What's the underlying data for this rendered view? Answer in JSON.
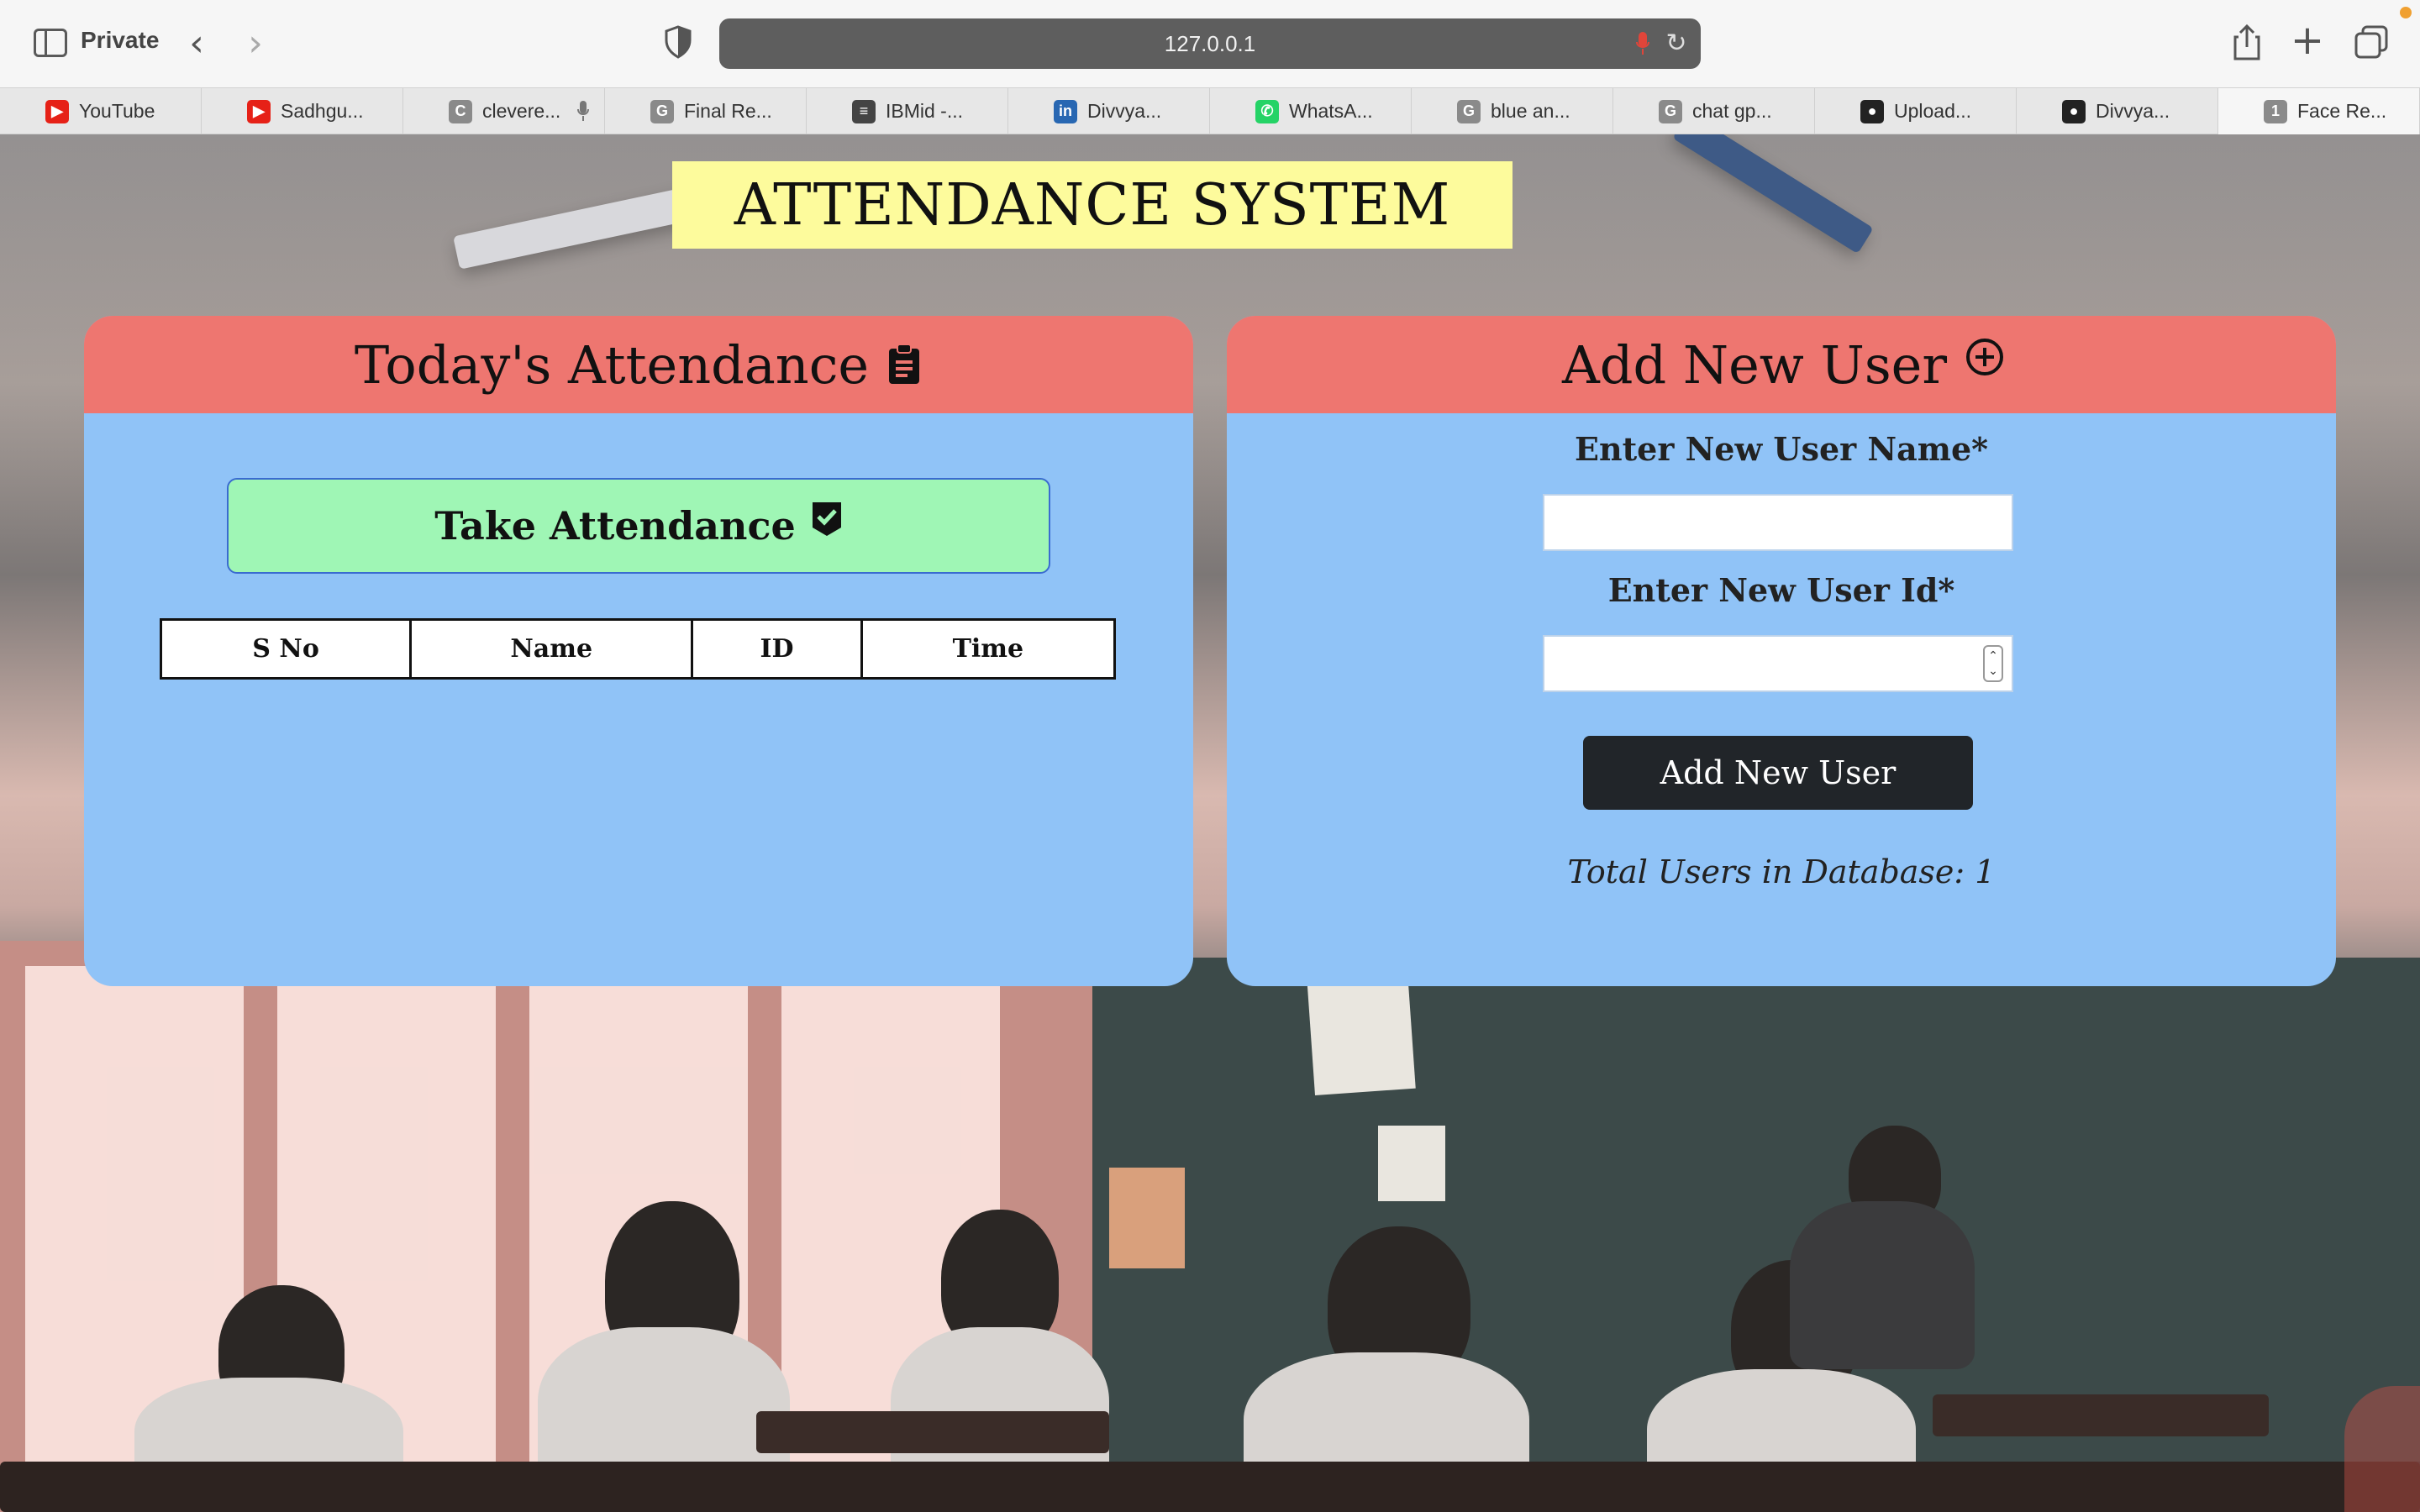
{
  "browser": {
    "private_label": "Private",
    "url": "127.0.0.1",
    "tabs": [
      {
        "label": "YouTube",
        "icon": "youtube-icon",
        "color": "#e62117",
        "glyph": "▶"
      },
      {
        "label": "Sadhgu...",
        "icon": "youtube-icon",
        "color": "#e62117",
        "glyph": "▶"
      },
      {
        "label": "clevere...",
        "icon": "letter-c-icon",
        "color": "#8a8a8a",
        "glyph": "C"
      },
      {
        "label": "Final Re...",
        "icon": "letter-g-icon",
        "color": "#8a8a8a",
        "glyph": "G"
      },
      {
        "label": "IBMid -...",
        "icon": "ibm-icon",
        "color": "#444444",
        "glyph": "≡"
      },
      {
        "label": "Divvya...",
        "icon": "linkedin-icon",
        "color": "#2867b2",
        "glyph": "in"
      },
      {
        "label": "WhatsA...",
        "icon": "whatsapp-icon",
        "color": "#25d366",
        "glyph": "✆"
      },
      {
        "label": "blue an...",
        "icon": "letter-g-icon",
        "color": "#8a8a8a",
        "glyph": "G"
      },
      {
        "label": "chat gp...",
        "icon": "letter-g-icon",
        "color": "#8a8a8a",
        "glyph": "G"
      },
      {
        "label": "Upload...",
        "icon": "github-icon",
        "color": "#222222",
        "glyph": "●"
      },
      {
        "label": "Divvya...",
        "icon": "github-icon",
        "color": "#222222",
        "glyph": "●"
      },
      {
        "label": "Face Re...",
        "icon": "number-1-icon",
        "color": "#8a8a8a",
        "glyph": "1"
      }
    ]
  },
  "page": {
    "title": "ATTENDANCE SYSTEM",
    "attendance_card": {
      "title": "Today's Attendance",
      "take_button": "Take Attendance",
      "columns": [
        "S No",
        "Name",
        "ID",
        "Time"
      ]
    },
    "add_user_card": {
      "title": "Add New User",
      "name_label": "Enter New User Name*",
      "name_value": "",
      "id_label": "Enter New User Id*",
      "id_value": "",
      "add_button": "Add New User",
      "total_users_text": "Total Users in Database: 1"
    }
  },
  "colors": {
    "title_bg": "#fdfb9c",
    "card_header": "#ee7670",
    "card_body": "#90c3f7",
    "take_button": "#9ff6b5",
    "add_button": "#212529"
  }
}
